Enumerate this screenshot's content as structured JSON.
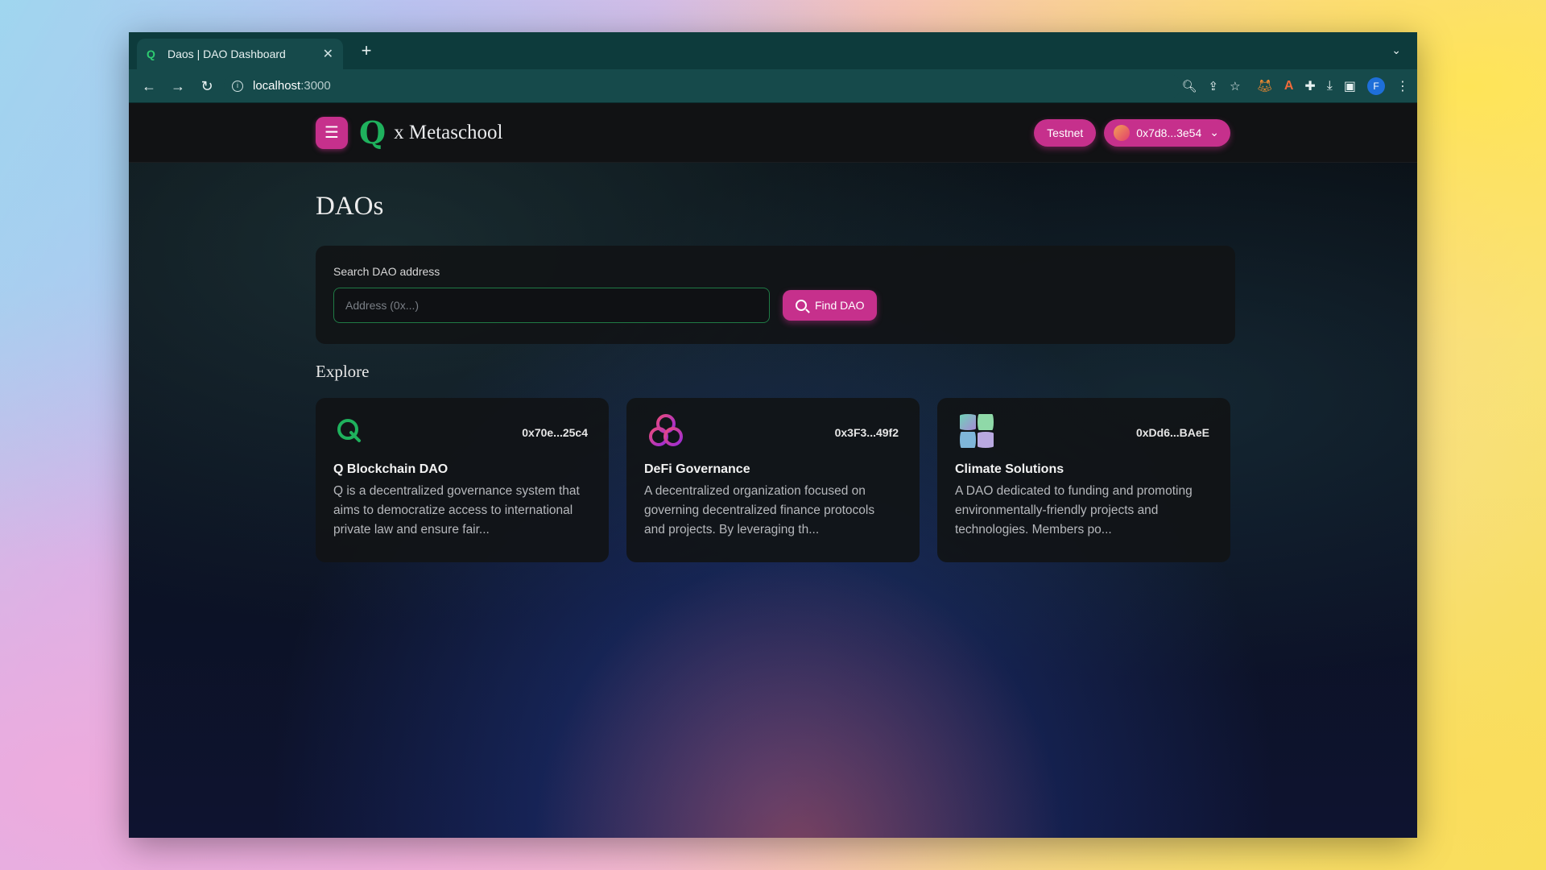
{
  "browser": {
    "tab_title": "Daos | DAO Dashboard",
    "new_tab_label": "+",
    "url_host": "localhost",
    "url_port": ":3000",
    "profile_initial": "F"
  },
  "header": {
    "brand_logo": "Q",
    "brand_text": "x Metaschool",
    "network_label": "Testnet",
    "wallet_address": "0x7d8...3e54"
  },
  "main": {
    "page_title": "DAOs",
    "search": {
      "label": "Search DAO address",
      "placeholder": "Address (0x...)",
      "value": "",
      "button_label": "Find DAO"
    },
    "explore_title": "Explore",
    "daos": [
      {
        "address": "0x70e...25c4",
        "name": "Q Blockchain DAO",
        "description": "Q is a decentralized governance system that aims to democratize access to international private law and ensure fair...",
        "logo": "q-logo"
      },
      {
        "address": "0x3F3...49f2",
        "name": "DeFi Governance",
        "description": "A decentralized organization focused on governing decentralized finance protocols and projects. By leveraging th...",
        "logo": "trefoil-logo"
      },
      {
        "address": "0xDd6...BAeE",
        "name": "Climate Solutions",
        "description": " A DAO dedicated to funding and promoting environmentally-friendly projects and technologies. Members po...",
        "logo": "clover-logo"
      }
    ]
  },
  "colors": {
    "accent": "#c6308c",
    "brand_green": "#1fb15d",
    "chrome_teal": "#164a4b"
  }
}
